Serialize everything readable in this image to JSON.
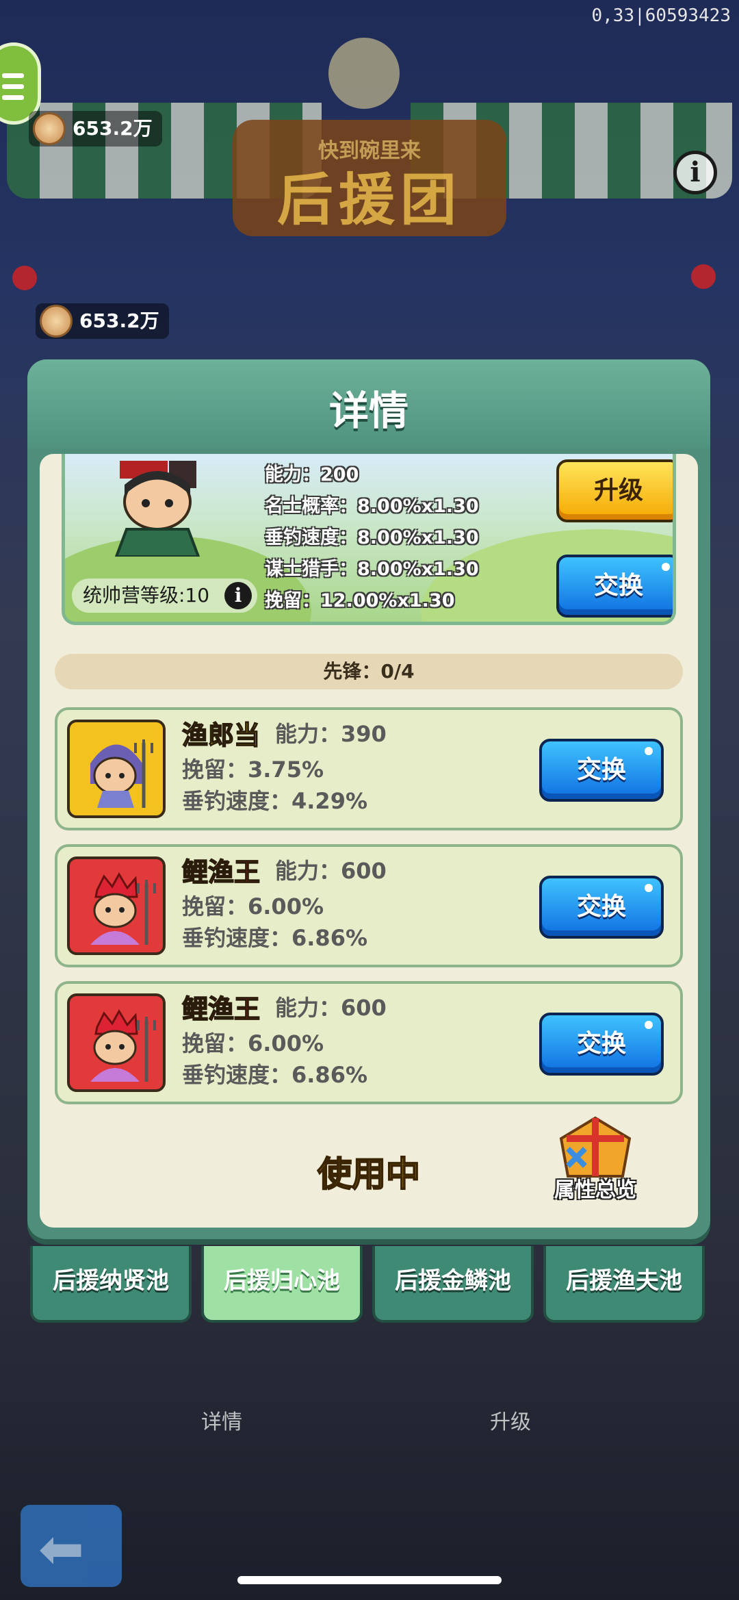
{
  "status_bar": {
    "debug_id": "0,33|60593423"
  },
  "hud": {
    "top_coins": "653.2万",
    "coins": "653.2万",
    "sign_title": "后援团",
    "sign_subtitle": "快到碗里来"
  },
  "dialog": {
    "title": "详情",
    "leader": {
      "stats": [
        "能力：200",
        "名士概率：8.00%x1.30",
        "垂钓速度：8.00%x1.30",
        "谋士猎手：8.00%x1.30",
        "挽留：12.00%x1.30"
      ],
      "camp_level": "统帅营等级:10",
      "upgrade_label": "升级",
      "swap_label": "交换"
    },
    "vanguard": "先锋：0/4",
    "heroes": [
      {
        "name": "渔郎当",
        "ability": "能力：390",
        "stat1": "挽留：3.75%",
        "stat2": "垂钓速度：4.29%",
        "swap_label": "交换",
        "name_color": "#f7e31f",
        "bg_color": "#f4c21f"
      },
      {
        "name": "鲤渔王",
        "ability": "能力：600",
        "stat1": "挽留：6.00%",
        "stat2": "垂钓速度：6.86%",
        "swap_label": "交换",
        "name_color": "#e8302b",
        "bg_color": "#e23a3a"
      },
      {
        "name": "鲤渔王",
        "ability": "能力：600",
        "stat1": "挽留：6.00%",
        "stat2": "垂钓速度：6.86%",
        "swap_label": "交换",
        "name_color": "#e8302b",
        "bg_color": "#e23a3a"
      }
    ],
    "in_use": "使用中",
    "overview_label": "属性总览"
  },
  "tabs": [
    {
      "label": "后援纳贤池",
      "active": false
    },
    {
      "label": "后援归心池",
      "active": true
    },
    {
      "label": "后援金鳞池",
      "active": false
    },
    {
      "label": "后援渔夫池",
      "active": false
    }
  ],
  "underlay": {
    "detail_label": "详情",
    "upgrade_label": "升级"
  }
}
